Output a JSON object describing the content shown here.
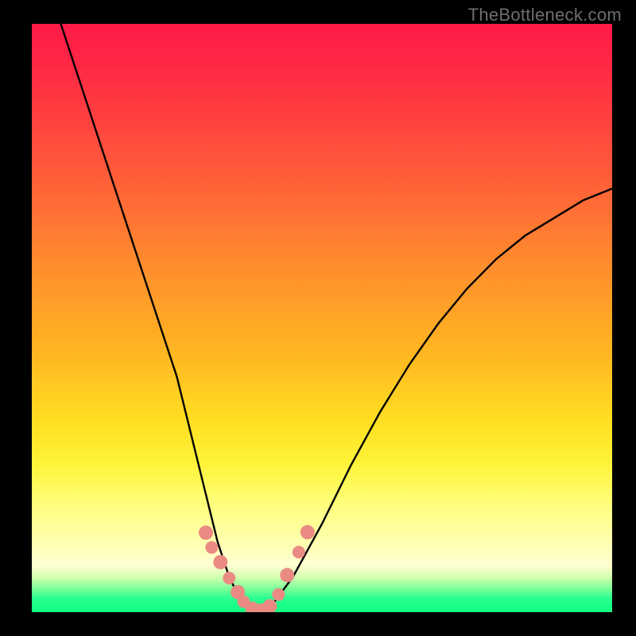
{
  "watermark": "TheBottleneck.com",
  "chart_data": {
    "type": "line",
    "title": "",
    "xlabel": "",
    "ylabel": "",
    "xlim": [
      0,
      100
    ],
    "ylim": [
      0,
      100
    ],
    "series": [
      {
        "name": "curve",
        "x": [
          5,
          10,
          15,
          20,
          25,
          28,
          30,
          32,
          34,
          36,
          38,
          40,
          42,
          45,
          50,
          55,
          60,
          65,
          70,
          75,
          80,
          85,
          90,
          95,
          100
        ],
        "values": [
          100,
          85,
          70,
          55,
          40,
          28,
          20,
          12,
          6,
          2,
          0,
          0,
          2,
          6,
          15,
          25,
          34,
          42,
          49,
          55,
          60,
          64,
          67,
          70,
          72
        ]
      }
    ],
    "markers": {
      "name": "salmon-dots",
      "color": "#e98b82",
      "x": [
        30,
        31,
        32.5,
        34,
        35.5,
        36.5,
        38,
        39.5,
        41,
        42.5,
        44,
        46,
        47.5
      ],
      "values": [
        13.5,
        11,
        8.5,
        5.8,
        3.4,
        1.8,
        0.6,
        0.4,
        1.0,
        3.0,
        6.3,
        10.2,
        13.6
      ]
    },
    "background_gradient": {
      "top_color": "#ff1a48",
      "mid_color": "#ffe022",
      "bottom_color": "#17ff84"
    }
  }
}
